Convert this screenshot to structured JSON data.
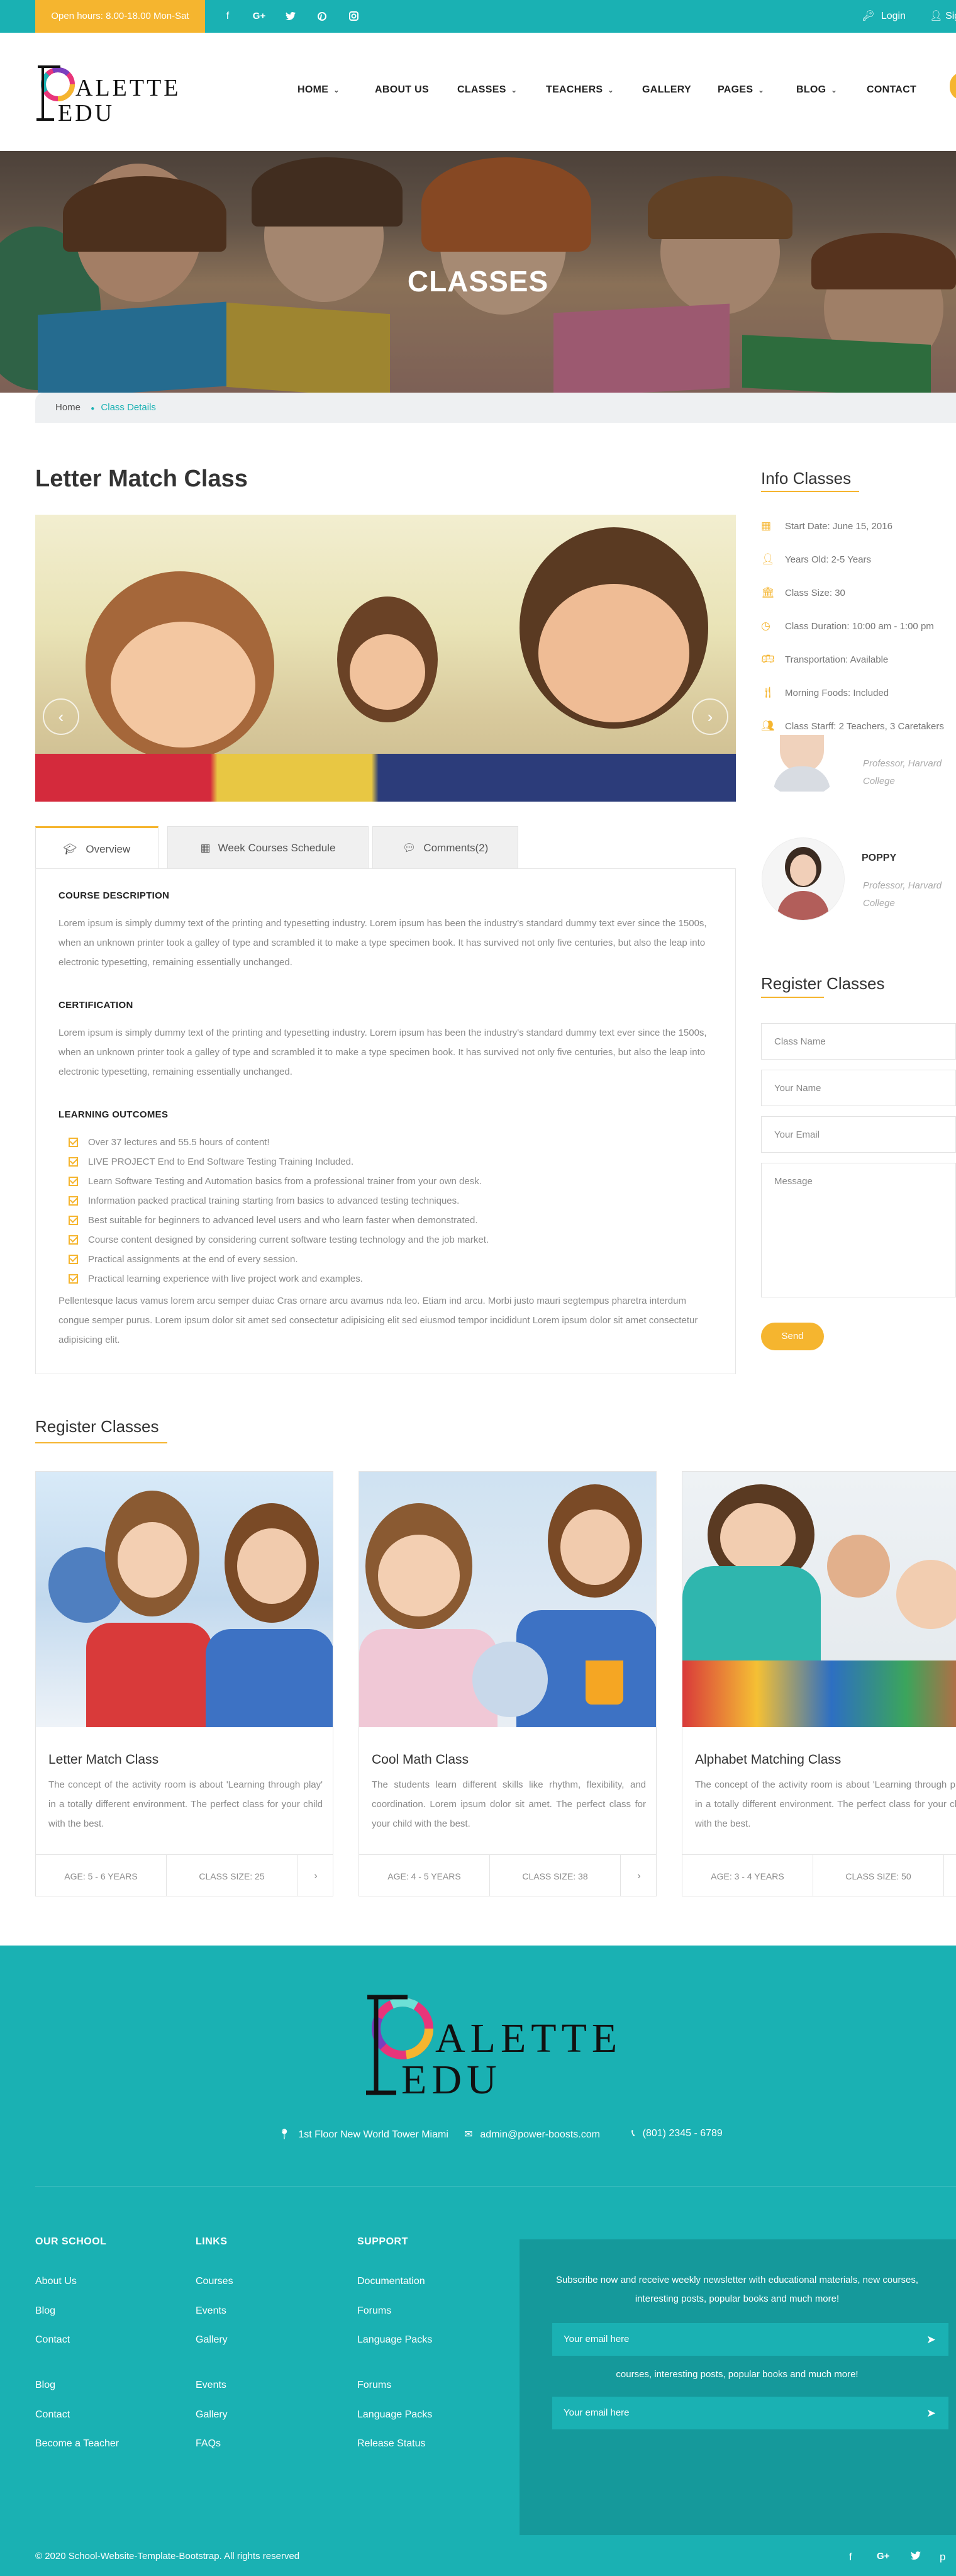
{
  "topbar": {
    "open_hours": "Open hours: 8.00-18.00 Mon-Sat",
    "social": [
      "f",
      "G+",
      "t",
      "p",
      "ig"
    ],
    "login": "Login",
    "signup": "Sign Up"
  },
  "header": {
    "logo_letters": "ALETTE",
    "logo_sub": "EDU",
    "nav": [
      {
        "label": "HOME",
        "dropdown": true
      },
      {
        "label": "ABOUT US",
        "dropdown": false
      },
      {
        "label": "CLASSES",
        "dropdown": true
      },
      {
        "label": "TEACHERS",
        "dropdown": true
      },
      {
        "label": "GALLERY",
        "dropdown": false
      },
      {
        "label": "PAGES",
        "dropdown": true
      },
      {
        "label": "BLOG",
        "dropdown": true
      },
      {
        "label": "CONTACT",
        "dropdown": false
      }
    ]
  },
  "hero": {
    "title": "CLASSES",
    "breadcrumb_home": "Home",
    "breadcrumb_current": "Class Details"
  },
  "main": {
    "title": "Letter Match Class",
    "tabs": [
      {
        "icon": "graduation-cap-icon",
        "label": "Overview"
      },
      {
        "icon": "calendar-icon",
        "label": "Week Courses Schedule"
      },
      {
        "icon": "comments-icon",
        "label": "Comments(2)"
      }
    ],
    "description_heading": "COURSE DESCRIPTION",
    "description": "Lorem ipsum is simply dummy text of the printing and typesetting industry. Lorem ipsum has been the industry's standard dummy text ever since the 1500s, when an unknown printer took a galley of type and scrambled it to make a type specimen book. It has survived not only five centuries, but also the leap into electronic typesetting, remaining essentially unchanged.",
    "certification_heading": "CERTIFICATION",
    "certification": "Lorem ipsum is simply dummy text of the printing and typesetting industry. Lorem ipsum has been the industry's standard dummy text ever since the 1500s, when an unknown printer took a galley of type and scrambled it to make a type specimen book. It has survived not only five centuries, but also the leap into electronic typesetting, remaining essentially unchanged.",
    "outcomes_heading": "LEARNING OUTCOMES",
    "outcomes": [
      "Over 37 lectures and 55.5 hours of content!",
      "LIVE PROJECT End to End Software Testing Training Included.",
      "Learn Software Testing and Automation basics from a professional trainer from your own desk.",
      "Information packed practical training starting from basics to advanced testing techniques.",
      "Best suitable for beginners to advanced level users and who learn faster when demonstrated.",
      "Course content designed by considering current software testing technology and the job market.",
      "Practical assignments at the end of every session.",
      "Practical learning experience with live project work and examples."
    ],
    "closing": "Pellentesque lacus vamus lorem arcu semper duiac Cras ornare arcu avamus nda leo. Etiam ind arcu. Morbi justo mauri segtempus pharetra interdum congue semper purus. Lorem ipsum dolor sit amet sed consectetur adipisicing elit sed eiusmod tempor incididunt Lorem ipsum dolor sit amet consectetur adipisicing elit."
  },
  "sidebar": {
    "info_title": "Info Classes",
    "info": [
      {
        "icon": "calendar-icon",
        "text": "Start Date: June 15, 2016"
      },
      {
        "icon": "user-icon",
        "text": "Years Old: 2-5 Years"
      },
      {
        "icon": "bank-icon",
        "text": "Class Size: 30"
      },
      {
        "icon": "clock-icon",
        "text": "Class Duration: 10:00 am - 1:00 pm"
      },
      {
        "icon": "bus-icon",
        "text": "Transportation: Available"
      },
      {
        "icon": "cutlery-icon",
        "text": "Morning Foods: Included"
      },
      {
        "icon": "users-icon",
        "text": "Class Starff: 2 Teachers, 3 Caretakers"
      }
    ],
    "teachers": [
      {
        "name": "",
        "role_line1": "Professor, Harvard",
        "role_line2": "College"
      },
      {
        "name": "POPPY",
        "role_line1": "Professor, Harvard",
        "role_line2": "College"
      }
    ],
    "register_title": "Register Classes",
    "form": {
      "class_name": "Class Name",
      "your_name": "Your Name",
      "your_email": "Your Email",
      "message": "Message",
      "send": "Send"
    }
  },
  "register": {
    "title": "Register Classes",
    "cards": [
      {
        "title": "Letter Match Class",
        "desc": "The concept of the activity room is about 'Learning through play' in a totally different environment. The perfect class for your child with the best.",
        "age": "AGE: 5 - 6 YEARS",
        "size": "CLASS SIZE: 25",
        "more": "›"
      },
      {
        "title": "Cool Math Class",
        "desc": "The students learn different skills like rhythm, flexibility, and coordination. Lorem ipsum dolor sit amet. The perfect class for your child with the best.",
        "age": "AGE: 4 - 5 YEARS",
        "size": "CLASS SIZE: 38",
        "more": "›"
      },
      {
        "title": "Alphabet Matching Class",
        "desc": "The concept of the activity room is about 'Learning through play' in a totally different environment. The perfect class for your child with the best.",
        "age": "AGE: 3 - 4 YEARS",
        "size": "CLASS SIZE: 50",
        "more": "›"
      }
    ]
  },
  "footer": {
    "logo_letters": "ALETTE",
    "logo_sub": "EDU",
    "address": "1st Floor New World Tower Miami",
    "email": "admin@power-boosts.com",
    "phone": "(801) 2345 - 6789",
    "columns": [
      {
        "title": "OUR SCHOOL",
        "links": [
          "About Us",
          "Blog",
          "Contact",
          "Become a Teacher",
          "Blog",
          "Contact",
          "Become a Teacher"
        ]
      },
      {
        "title": "LINKS",
        "links": [
          "Courses",
          "Events",
          "Gallery",
          "FAQs",
          "Events",
          "Gallery",
          "FAQs"
        ]
      },
      {
        "title": "SUPPORT",
        "links": [
          "Documentation",
          "Forums",
          "Language Packs",
          "Release Status",
          "Forums",
          "Language Packs",
          "Release Status"
        ]
      }
    ],
    "newsletter_text": "Subscribe now and receive weekly newsletter with educational materials, new courses, interesting posts, popular books and much more!",
    "newsletter_text_2": "courses, interesting posts, popular books and much more!",
    "email_placeholder": "Your email here",
    "copyright": "© 2020 School-Website-Template-Bootstrap. All rights reserved",
    "social": [
      "f",
      "G+",
      "t",
      "p"
    ]
  }
}
